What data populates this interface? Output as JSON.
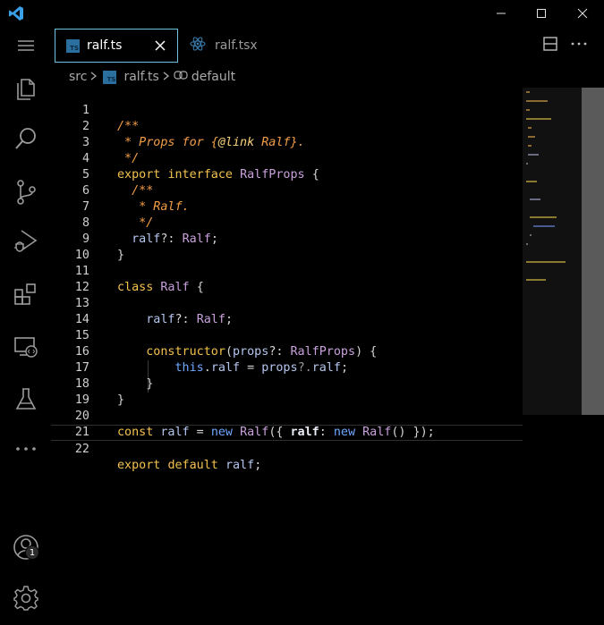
{
  "window": {
    "minimize_label": "minimize",
    "maximize_label": "maximize",
    "close_label": "close"
  },
  "activity_bar": {
    "items": [
      {
        "name": "menu-icon"
      },
      {
        "name": "explorer-icon"
      },
      {
        "name": "search-icon"
      },
      {
        "name": "source-control-icon"
      },
      {
        "name": "run-debug-icon"
      },
      {
        "name": "extensions-icon"
      },
      {
        "name": "remote-explorer-icon"
      },
      {
        "name": "testing-icon"
      },
      {
        "name": "more-icon"
      }
    ],
    "accounts_badge": "1"
  },
  "tabs": [
    {
      "label": "ralf.ts",
      "icon": "ts-file-icon",
      "active": true
    },
    {
      "label": "ralf.tsx",
      "icon": "react-icon",
      "active": false
    }
  ],
  "breadcrumb": {
    "folder": "src",
    "file": "ralf.ts",
    "symbol": "default"
  },
  "code_lines": [
    {
      "n": "1"
    },
    {
      "n": "2"
    },
    {
      "n": "3"
    },
    {
      "n": "4"
    },
    {
      "n": "5"
    },
    {
      "n": "6"
    },
    {
      "n": "7"
    },
    {
      "n": "8"
    },
    {
      "n": "9"
    },
    {
      "n": "10"
    },
    {
      "n": "11"
    },
    {
      "n": "12"
    },
    {
      "n": "13"
    },
    {
      "n": "14"
    },
    {
      "n": "15"
    },
    {
      "n": "16"
    },
    {
      "n": "17"
    },
    {
      "n": "18"
    },
    {
      "n": "19"
    },
    {
      "n": "20"
    },
    {
      "n": "21"
    },
    {
      "n": "22"
    }
  ],
  "code": {
    "l1": "/**",
    "l2a": " * Props for {",
    "l2b": "@link",
    "l2c": " Ralf",
    "l2d": "}.",
    "l3": " */",
    "l4a": "export",
    "l4b": "interface",
    "l4c": "RalfProps",
    "l4d": "{",
    "l5": "  /**",
    "l6": "   * Ralf.",
    "l7": "   */",
    "l8a": "  ralf",
    "l8b": "?:",
    "l8c": "Ralf",
    "l8d": ";",
    "l9": "}",
    "l11a": "class",
    "l11b": "Ralf",
    "l11c": "{",
    "l13a": "    ralf",
    "l13b": "?:",
    "l13c": "Ralf",
    "l13d": ";",
    "l15a": "    constructor",
    "l15b": "(",
    "l15c": "props",
    "l15d": "?:",
    "l15e": "RalfProps",
    "l15f": ") {",
    "l16a": "        this",
    "l16b": ".",
    "l16c": "ralf",
    "l16d": " = ",
    "l16e": "props",
    "l16f": "?.",
    "l16g": "ralf",
    "l16h": ";",
    "l17": "    }",
    "l18": "}",
    "l20a": "const",
    "l20b": "ralf",
    "l20c": " = ",
    "l20d": "new",
    "l20e": "Ralf",
    "l20f": "({ ",
    "l20g": "ralf",
    "l20h": ": ",
    "l20i": "new",
    "l20j": "Ralf",
    "l20k": "() });",
    "l22a": "export",
    "l22b": "default",
    "l22c": "ralf",
    "l22d": ";"
  },
  "colors": {
    "keyword": "#f2c14e",
    "comment": "#f29d49",
    "type": "#c9a0dc",
    "variable": "#b4c6f0",
    "this": "#6ea8ff",
    "tab_border": "#6fc3df"
  }
}
